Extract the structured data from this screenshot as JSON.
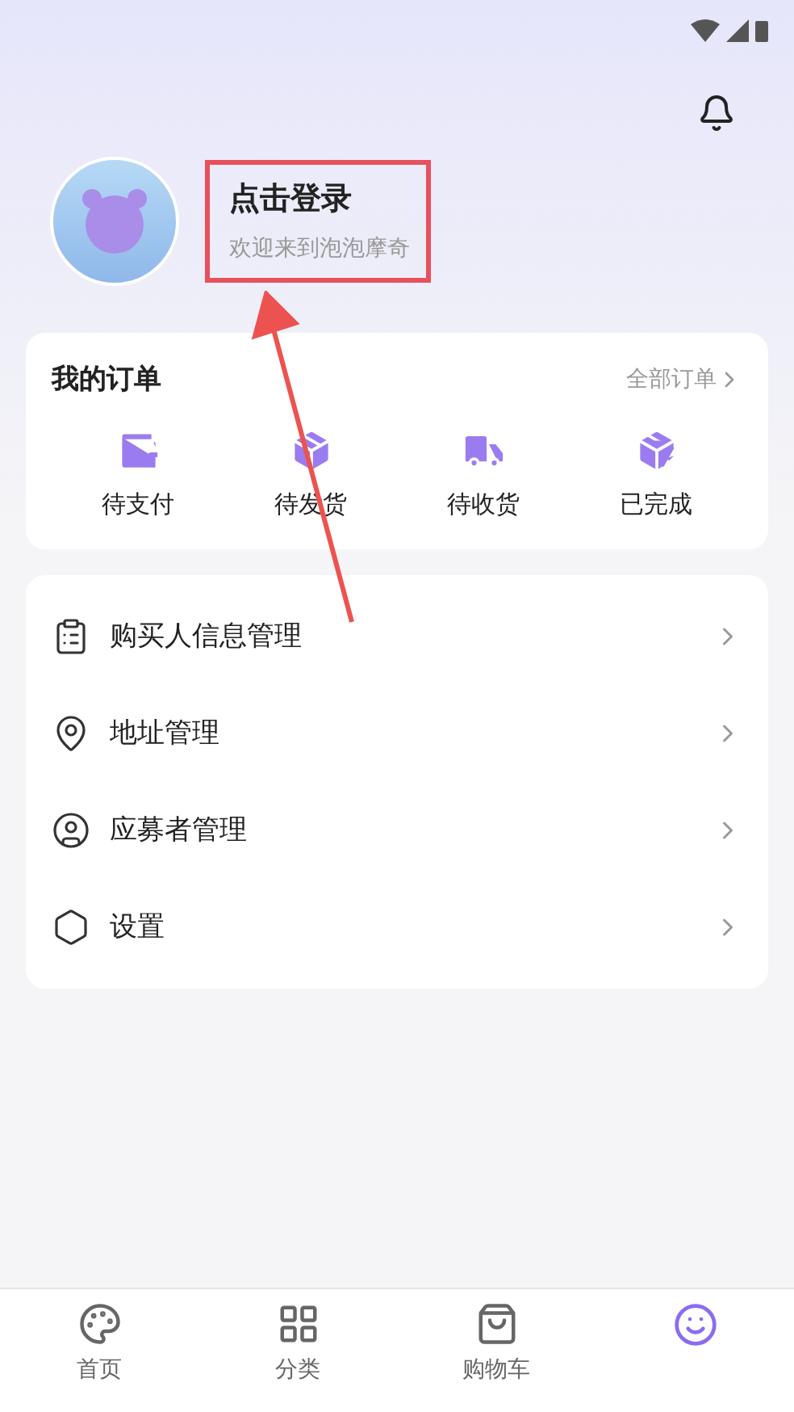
{
  "profile": {
    "title": "点击登录",
    "subtitle": "欢迎来到泡泡摩奇"
  },
  "orders": {
    "title": "我的订单",
    "all_link": "全部订单",
    "items": [
      {
        "label": "待支付",
        "kind": "wallet"
      },
      {
        "label": "待发货",
        "kind": "package"
      },
      {
        "label": "待收货",
        "kind": "truck"
      },
      {
        "label": "已完成",
        "kind": "done"
      }
    ]
  },
  "menu": [
    {
      "label": "购买人信息管理",
      "kind": "clipboard"
    },
    {
      "label": "地址管理",
      "kind": "pin"
    },
    {
      "label": "应募者管理",
      "kind": "user"
    },
    {
      "label": "设置",
      "kind": "settings"
    }
  ],
  "tab_bar": [
    {
      "label": "首页",
      "kind": "home",
      "selected": false
    },
    {
      "label": "分类",
      "kind": "category",
      "selected": false
    },
    {
      "label": "购物车",
      "kind": "cart",
      "selected": false
    },
    {
      "kind": "mine",
      "selected": true
    }
  ]
}
